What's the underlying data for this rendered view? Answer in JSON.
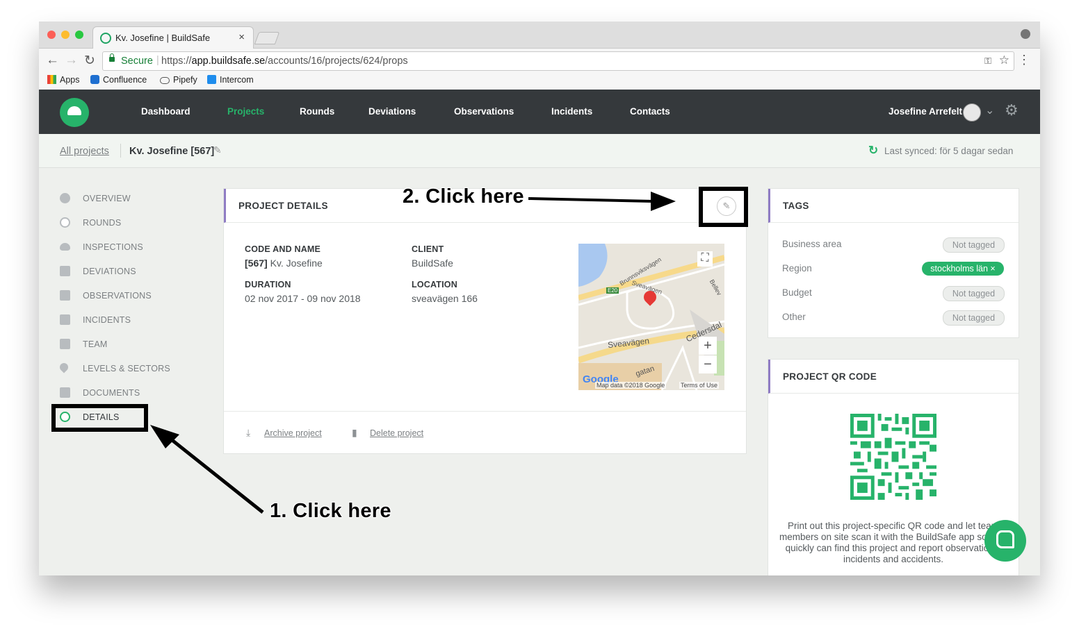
{
  "browser": {
    "tab_title": "Kv. Josefine | BuildSafe",
    "tab_close": "×",
    "secure_label": "Secure",
    "url_scheme": "https://",
    "url_host": "app.buildsafe.se",
    "url_path": "/accounts/16/projects/624/props",
    "bookmarks": [
      "Apps",
      "Confluence",
      "Pipefy",
      "Intercom"
    ]
  },
  "nav": {
    "items": [
      "Dashboard",
      "Projects",
      "Rounds",
      "Deviations",
      "Observations",
      "Incidents",
      "Contacts"
    ],
    "active": "Projects",
    "user_name": "Josefine Arrefelt"
  },
  "breadcrumb": {
    "all_projects": "All projects",
    "current": "Kv. Josefine [567]",
    "sync_text": "Last synced: för 5 dagar sedan"
  },
  "sidebar": {
    "items": [
      {
        "label": "OVERVIEW",
        "icon": "info-icon"
      },
      {
        "label": "ROUNDS",
        "icon": "rounds-icon"
      },
      {
        "label": "INSPECTIONS",
        "icon": "cloud-icon"
      },
      {
        "label": "DEVIATIONS",
        "icon": "document-icon"
      },
      {
        "label": "OBSERVATIONS",
        "icon": "document-icon"
      },
      {
        "label": "INCIDENTS",
        "icon": "document-icon"
      },
      {
        "label": "TEAM",
        "icon": "person-card-icon"
      },
      {
        "label": "LEVELS & SECTORS",
        "icon": "location-pin-icon"
      },
      {
        "label": "DOCUMENTS",
        "icon": "file-icon"
      },
      {
        "label": "DETAILS",
        "icon": "details-icon"
      }
    ],
    "active": "DETAILS"
  },
  "project_details": {
    "title": "PROJECT DETAILS",
    "code_and_name_label": "CODE AND NAME",
    "code": "[567]",
    "name": " Kv. Josefine",
    "client_label": "CLIENT",
    "client": "BuildSafe",
    "duration_label": "DURATION",
    "duration": "02 nov 2017 - 09 nov 2018",
    "location_label": "LOCATION",
    "location": "sveavägen 166",
    "archive_label": "Archive project",
    "delete_label": "Delete project"
  },
  "map": {
    "labels": [
      "Brunnsviksvägen",
      "Sveavägen",
      "Sveavägen",
      "Cedersdal",
      "Bellev",
      "E20",
      "gatan"
    ],
    "zoom_in": "+",
    "zoom_out": "−",
    "attribution": "Map data ©2018 Google",
    "terms": "Terms of Use",
    "google": "Google"
  },
  "tags": {
    "title": "TAGS",
    "rows": [
      {
        "label": "Business area",
        "value": "Not tagged",
        "tagged": false
      },
      {
        "label": "Region",
        "value": "stockholms län ×",
        "tagged": true
      },
      {
        "label": "Budget",
        "value": "Not tagged",
        "tagged": false
      },
      {
        "label": "Other",
        "value": "Not tagged",
        "tagged": false
      }
    ]
  },
  "qr": {
    "title": "PROJECT QR CODE",
    "description": "Print out this project-specific QR code and let team members on site scan it with the BuildSafe app so they quickly can find this project and report observations, incidents and accidents."
  },
  "annotations": {
    "step1": "1. Click here",
    "step2": "2. Click here"
  },
  "colors": {
    "brand": "#27b36a",
    "header_bg": "#35393c",
    "accent_border": "#8f7cc4"
  }
}
